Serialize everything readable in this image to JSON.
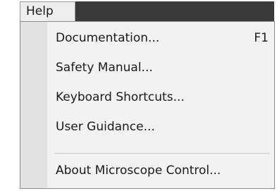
{
  "menubar": {
    "active_menu": "Help"
  },
  "help_menu": {
    "items": [
      {
        "label": "Documentation...",
        "shortcut": "F1"
      },
      {
        "label": "Safety Manual...",
        "shortcut": ""
      },
      {
        "label": "Keyboard Shortcuts...",
        "shortcut": ""
      },
      {
        "label": "User Guidance...",
        "shortcut": ""
      },
      {
        "label": "About Microscope Control...",
        "shortcut": ""
      }
    ]
  },
  "colors": {
    "menubar_background": "#3a3a3a",
    "menu_background": "#f2f2f2",
    "icon_gutter": "#e2e2e2",
    "separator": "#c8c8c8"
  }
}
